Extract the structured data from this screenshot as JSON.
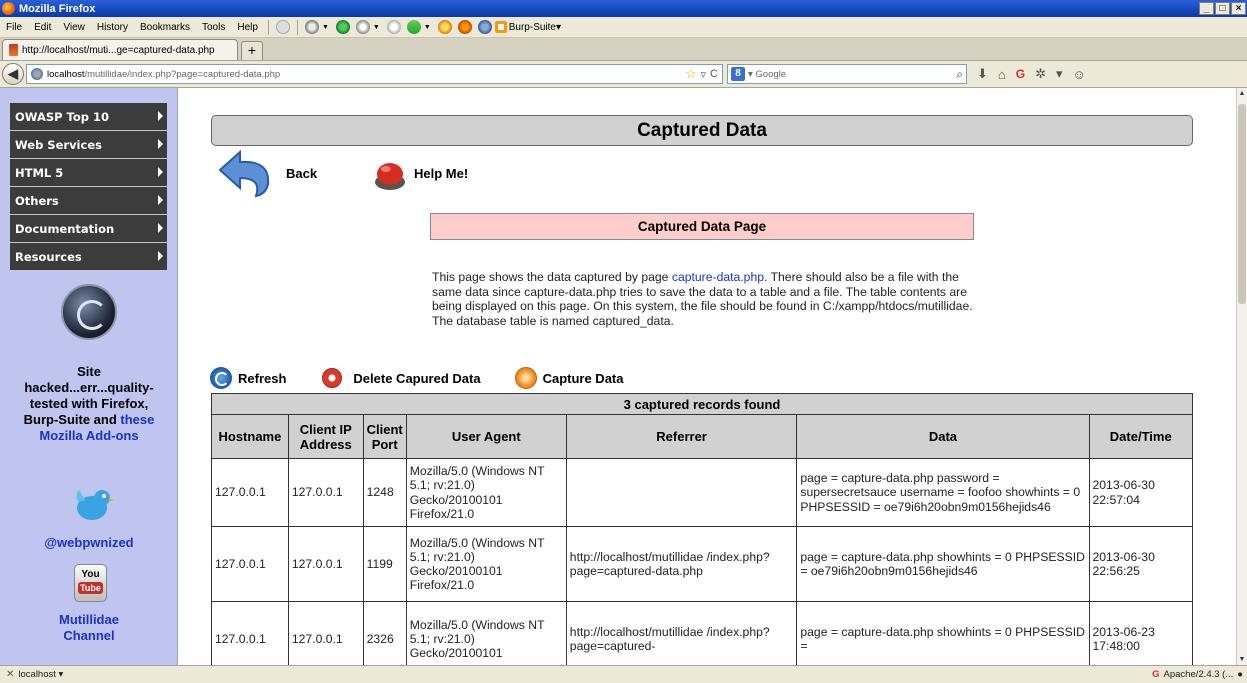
{
  "window": {
    "title": "Mozilla Firefox",
    "controls": [
      "_",
      "□",
      "×"
    ]
  },
  "menu": {
    "items": [
      "File",
      "Edit",
      "View",
      "History",
      "Bookmarks",
      "Tools",
      "Help"
    ],
    "burp_label": "Burp-Suite▾"
  },
  "tab": {
    "title": "http://localhost/muti...ge=captured-data.php",
    "new_tab": "+"
  },
  "nav": {
    "url_host": "localhost",
    "url_path": "/mutillidae/index.php?page=captured-data.php",
    "search_placeholder": "Google",
    "search_engine_badge": "8"
  },
  "sidebar": {
    "items": [
      {
        "label": "OWASP Top 10"
      },
      {
        "label": "Web Services"
      },
      {
        "label": "HTML 5"
      },
      {
        "label": "Others"
      },
      {
        "label": "Documentation"
      },
      {
        "label": "Resources"
      }
    ],
    "tested_lines": [
      "Site",
      "hacked...err...quality-",
      "tested with Firefox,",
      "Burp-Suite and"
    ],
    "addons_link_1": "these",
    "addons_link_2": "Mozilla Add-ons",
    "twitter_handle": "@webpwnized",
    "youtube_top": "You",
    "youtube_bottom": "Tube",
    "channel_line_1": "Mutillidae",
    "channel_line_2": "Channel"
  },
  "main": {
    "page_title": "Captured Data",
    "back_label": "Back",
    "help_label": "Help Me!",
    "subtitle": "Captured Data Page",
    "desc_before": "This page shows the data captured by page ",
    "desc_link": "capture-data.php",
    "desc_after": ". There should also be a file with the same data since capture-data.php tries to save the data to a table and a file. The table contents are being displayed on this page. On this system, the file should be found in C:/xampp/htdocs/mutillidae. The database table is named captured_data.",
    "actions": {
      "refresh": "Refresh",
      "delete": "Delete Capured Data",
      "capture": "Capture Data"
    }
  },
  "table": {
    "caption": "3 captured records found",
    "headers": [
      "Hostname",
      "Client IP Address",
      "Client Port",
      "User Agent",
      "Referrer",
      "Data",
      "Date/Time"
    ],
    "rows": [
      {
        "hostname": "127.0.0.1",
        "ip": "127.0.0.1",
        "port": "1248",
        "user_agent": "Mozilla/5.0 (Windows NT 5.1; rv:21.0) Gecko/20100101 Firefox/21.0",
        "referrer": "",
        "data": "page = capture-data.php password = supersecretsauce username = foofoo showhints = 0 PHPSESSID = oe79i6h20obn9m0156hejids46",
        "datetime": "2013-06-30 22:57:04"
      },
      {
        "hostname": "127.0.0.1",
        "ip": "127.0.0.1",
        "port": "1199",
        "user_agent": "Mozilla/5.0 (Windows NT 5.1; rv:21.0) Gecko/20100101 Firefox/21.0",
        "referrer": "http://localhost/mutillidae /index.php?page=captured-data.php",
        "data": "page = capture-data.php showhints = 0 PHPSESSID = oe79i6h20obn9m0156hejids46",
        "datetime": "2013-06-30 22:56:25"
      },
      {
        "hostname": "127.0.0.1",
        "ip": "127.0.0.1",
        "port": "2326",
        "user_agent": "Mozilla/5.0 (Windows NT 5.1; rv:21.0) Gecko/20100101",
        "referrer": "http://localhost/mutillidae /index.php?page=captured-",
        "data": "page = capture-data.php showhints = 0 PHPSESSID =",
        "datetime": "2013-06-23 17:48:00"
      }
    ]
  },
  "status": {
    "left": "localhost",
    "server": "Apache/2.4.3 (..."
  },
  "colors": {
    "sidebar_bg": "#bfc5ee",
    "menu_item_bg": "#3c3c3c",
    "title_box_bg": "#d1d1d1",
    "subtitle_bg": "#ffcccc",
    "link": "#1a34c8"
  }
}
